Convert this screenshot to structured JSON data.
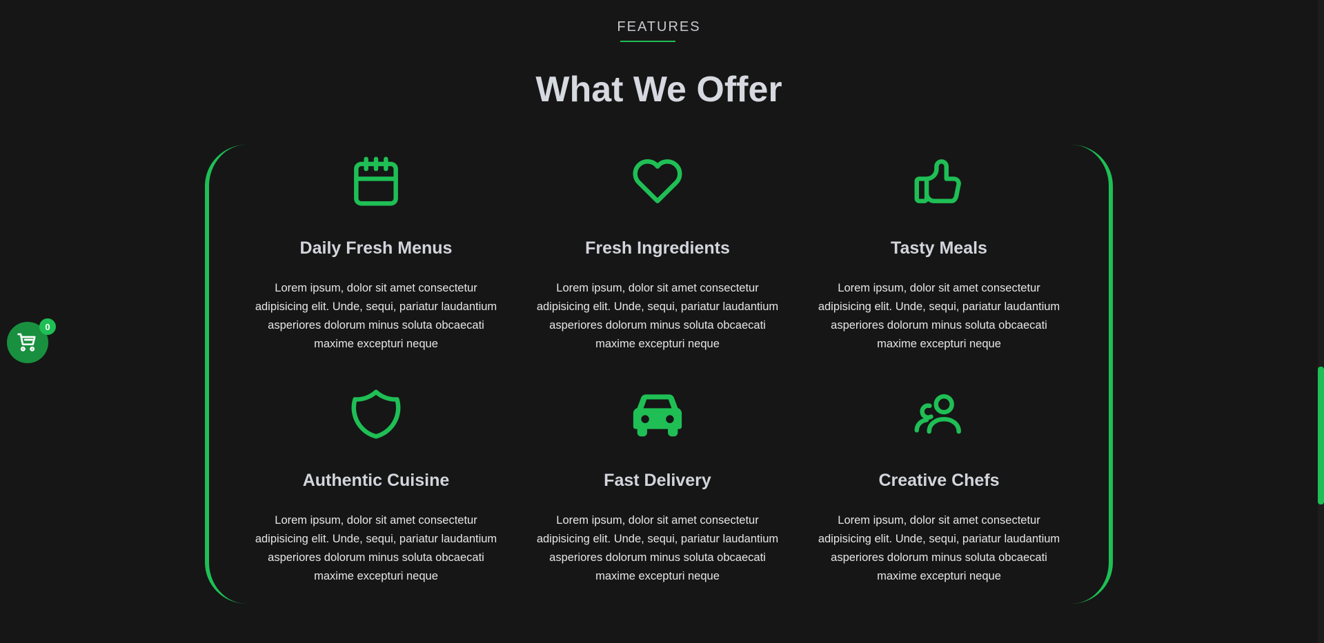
{
  "section": {
    "eyebrow": "FEATURES",
    "heading": "What We Offer"
  },
  "features": [
    {
      "icon": "calendar-icon",
      "title": "Daily Fresh Menus",
      "desc": "Lorem ipsum, dolor sit amet consectetur adipisicing elit. Unde, sequi, pariatur laudantium asperiores dolorum minus soluta obcaecati maxime excepturi neque"
    },
    {
      "icon": "heart-icon",
      "title": "Fresh Ingredients",
      "desc": "Lorem ipsum, dolor sit amet consectetur adipisicing elit. Unde, sequi, pariatur laudantium asperiores dolorum minus soluta obcaecati maxime excepturi neque"
    },
    {
      "icon": "thumbs-up-icon",
      "title": "Tasty Meals",
      "desc": "Lorem ipsum, dolor sit amet consectetur adipisicing elit. Unde, sequi, pariatur laudantium asperiores dolorum minus soluta obcaecati maxime excepturi neque"
    },
    {
      "icon": "shield-icon",
      "title": "Authentic Cuisine",
      "desc": "Lorem ipsum, dolor sit amet consectetur adipisicing elit. Unde, sequi, pariatur laudantium asperiores dolorum minus soluta obcaecati maxime excepturi neque"
    },
    {
      "icon": "car-icon",
      "title": "Fast Delivery",
      "desc": "Lorem ipsum, dolor sit amet consectetur adipisicing elit. Unde, sequi, pariatur laudantium asperiores dolorum minus soluta obcaecati maxime excepturi neque"
    },
    {
      "icon": "users-icon",
      "title": "Creative Chefs",
      "desc": "Lorem ipsum, dolor sit amet consectetur adipisicing elit. Unde, sequi, pariatur laudantium asperiores dolorum minus soluta obcaecati maxime excepturi neque"
    }
  ],
  "cart": {
    "icon": "cart-icon",
    "count": "0"
  },
  "colors": {
    "accent": "#1fbf55",
    "background": "#161616",
    "cart_bg": "#19903f"
  }
}
